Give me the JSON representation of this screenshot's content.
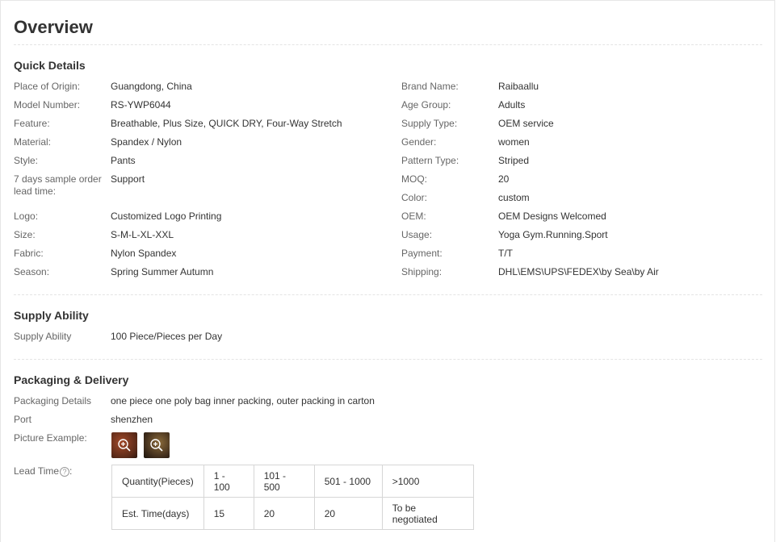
{
  "title": "Overview",
  "quick_details": {
    "heading": "Quick Details",
    "left": [
      {
        "label": "Place of Origin:",
        "value": "Guangdong, China"
      },
      {
        "label": "Model Number:",
        "value": "RS-YWP6044"
      },
      {
        "label": "Feature:",
        "value": "Breathable, Plus Size, QUICK DRY, Four-Way Stretch"
      },
      {
        "label": "Material:",
        "value": "Spandex / Nylon"
      },
      {
        "label": "Style:",
        "value": "Pants"
      },
      {
        "label": "7 days sample order lead time:",
        "value": "Support"
      },
      {
        "label": "Logo:",
        "value": "Customized Logo Printing"
      },
      {
        "label": "Size:",
        "value": "S-M-L-XL-XXL"
      },
      {
        "label": "Fabric:",
        "value": "Nylon Spandex"
      },
      {
        "label": "Season:",
        "value": "Spring Summer Autumn"
      }
    ],
    "right": [
      {
        "label": "Brand Name:",
        "value": "Raibaallu"
      },
      {
        "label": "Age Group:",
        "value": "Adults"
      },
      {
        "label": "Supply Type:",
        "value": "OEM service"
      },
      {
        "label": "Gender:",
        "value": "women"
      },
      {
        "label": "Pattern Type:",
        "value": "Striped"
      },
      {
        "label": "MOQ:",
        "value": "20"
      },
      {
        "label": "Color:",
        "value": "custom"
      },
      {
        "label": "OEM:",
        "value": "OEM Designs Welcomed"
      },
      {
        "label": "Usage:",
        "value": "Yoga Gym.Running.Sport"
      },
      {
        "label": "Payment:",
        "value": "T/T"
      },
      {
        "label": "Shipping:",
        "value": "DHL\\EMS\\UPS\\FEDEX\\by Sea\\by Air"
      }
    ]
  },
  "supply_ability": {
    "heading": "Supply Ability",
    "label": "Supply Ability",
    "value": "100 Piece/Pieces per Day"
  },
  "packaging": {
    "heading": "Packaging & Delivery",
    "details_label": "Packaging Details",
    "details_value": "one piece one poly bag inner packing, outer packing in carton",
    "port_label": "Port",
    "port_value": "shenzhen",
    "picture_label": "Picture Example:",
    "lead_time_label": "Lead Time",
    "lead_time_colon": ":",
    "help_glyph": "?",
    "lead_table": {
      "row1": [
        "Quantity(Pieces)",
        "1 - 100",
        "101 - 500",
        "501 - 1000",
        ">1000"
      ],
      "row2": [
        "Est. Time(days)",
        "15",
        "20",
        "20",
        "To be negotiated"
      ]
    }
  }
}
